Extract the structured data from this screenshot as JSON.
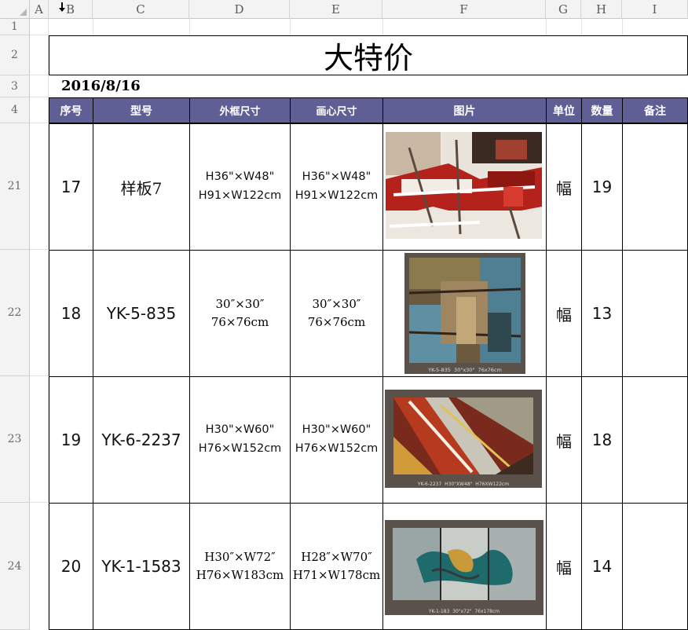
{
  "sheet": {
    "columns": [
      "A",
      "B",
      "C",
      "D",
      "E",
      "F",
      "G",
      "H",
      "I"
    ],
    "row_numbers": [
      "1",
      "2",
      "3",
      "4",
      "21",
      "22",
      "23",
      "24"
    ],
    "title": "大特价",
    "date": "2016/8/16",
    "table_headers": [
      "序号",
      "型号",
      "外框尺寸",
      "画心尺寸",
      "图片",
      "单位",
      "数量",
      "备注"
    ],
    "rows": [
      {
        "no": "17",
        "model": "样板7",
        "frame": [
          "H36\"×W48\"",
          "H91×W122cm"
        ],
        "canvas": [
          "H36\"×W48\"",
          "H91×W122cm"
        ],
        "picture_caption": "",
        "unit": "幅",
        "qty": "19",
        "note": ""
      },
      {
        "no": "18",
        "model": "YK-5-835",
        "frame": [
          "30″×30″",
          "76×76cm"
        ],
        "canvas": [
          "30″×30″",
          "76×76cm"
        ],
        "picture_caption": "YK-5-835  30\"x30\"  76x76cm",
        "unit": "幅",
        "qty": "13",
        "note": ""
      },
      {
        "no": "19",
        "model": "YK-6-2237",
        "frame": [
          "H30\"×W60\"",
          "H76×W152cm"
        ],
        "canvas": [
          "H30\"×W60\"",
          "H76×W152cm"
        ],
        "picture_caption": "YK-6-2237  H30\"XW48\"  H76XW122cm",
        "unit": "幅",
        "qty": "18",
        "note": ""
      },
      {
        "no": "20",
        "model": "YK-1-1583",
        "frame": [
          "H30″×W72″",
          "H76×W183cm"
        ],
        "canvas": [
          "H28″×W70″",
          "H71×W178cm"
        ],
        "picture_caption": "YK-1-183  30\"x72\"  76x178cm",
        "unit": "幅",
        "qty": "14",
        "note": ""
      }
    ]
  },
  "colors": {
    "header_bg": "#5f5f96",
    "header_text": "#ffffff",
    "grid": "#e2e2e2",
    "heading_bg": "#f3f3f3"
  }
}
